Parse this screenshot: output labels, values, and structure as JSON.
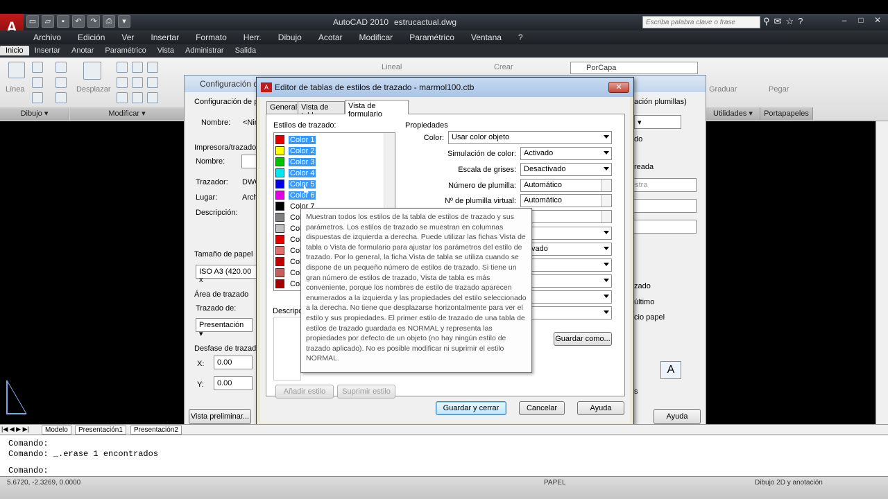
{
  "app": {
    "title": "AutoCAD 2010",
    "filename": "estrucactual.dwg",
    "logo_letter": "A",
    "search_placeholder": "Escriba palabra clave o frase"
  },
  "menubar": [
    "Archivo",
    "Edición",
    "Ver",
    "Insertar",
    "Formato",
    "Herr.",
    "Dibujo",
    "Acotar",
    "Modificar",
    "Paramétrico",
    "Ventana",
    "?"
  ],
  "ribbon_tabs": [
    "Inicio",
    "Insertar",
    "Anotar",
    "Paramétrico",
    "Vista",
    "Administrar",
    "Salida"
  ],
  "ribbon": {
    "panels": [
      "Dibujo",
      "Modificar",
      "Utilidades",
      "Portapapeles"
    ],
    "labels": {
      "linea": "Línea",
      "desplazar": "Desplazar",
      "lineal": "Lineal",
      "crear": "Crear",
      "porcapa": "PorCapa",
      "graduar": "Graduar",
      "pegar": "Pegar"
    }
  },
  "bg_dialog": {
    "title": "Configuración d",
    "config_label": "Configuración de pá",
    "nombre_label": "Nombre:",
    "nombre_value": "<Nin",
    "impresora_label": "Impresora/trazador",
    "nombre2_label": "Nombre:",
    "trazador_label": "Trazador:",
    "trazador_value": "DWG",
    "lugar_label": "Lugar:",
    "lugar_value": "Arch",
    "descripcion_label": "Descripción:",
    "tamano_label": "Tamaño de papel",
    "tamano_value": "ISO A3 (420.00 x",
    "area_label": "Área de trazado",
    "trazado_de_label": "Trazado de:",
    "trazado_de_value": "Presentación",
    "desfase_label": "Desfase de trazado",
    "x_label": "X:",
    "x_value": "0.00",
    "y_label": "Y:",
    "y_value": "0.00",
    "vista_btn": "Vista preliminar...",
    "ayuda_btn": "Ayuda",
    "right_plumillas": "ación plumillas)",
    "right_do": "do",
    "right_reada": "reada",
    "right_estra": "estra",
    "right_zado": "zado",
    "right_ultimo": "último",
    "right_papel": "cio papel",
    "right_s": "s",
    "right_a": "A"
  },
  "dialog": {
    "title": "Editor de tablas de estilos de trazado - marmol100.ctb",
    "tabs": [
      "General",
      "Vista de tabla",
      "Vista de formulario"
    ],
    "estilos_label": "Estilos de trazado:",
    "styles": [
      {
        "name": "Color 1",
        "color": "#e00000",
        "selected": true
      },
      {
        "name": "Color 2",
        "color": "#ffff00",
        "selected": true
      },
      {
        "name": "Color 3",
        "color": "#00c000",
        "selected": true
      },
      {
        "name": "Color 4",
        "color": "#00e5ee",
        "selected": true
      },
      {
        "name": "Color 5",
        "color": "#0000e0",
        "selected": true
      },
      {
        "name": "Color 6",
        "color": "#e000e0",
        "selected": true
      },
      {
        "name": "Color 7",
        "color": "#000000",
        "selected": false
      },
      {
        "name": "Color",
        "color": "#808080",
        "selected": false
      },
      {
        "name": "Color",
        "color": "#c0c0c0",
        "selected": false
      },
      {
        "name": "Color",
        "color": "#e00000",
        "selected": false
      },
      {
        "name": "Color",
        "color": "#e07070",
        "selected": false
      },
      {
        "name": "Color",
        "color": "#c00000",
        "selected": false
      },
      {
        "name": "Color",
        "color": "#c06060",
        "selected": false
      },
      {
        "name": "Color",
        "color": "#a00000",
        "selected": false
      }
    ],
    "descripcion_label": "Descripc",
    "anadir_btn": "Añadir estilo",
    "suprimir_btn": "Suprimir estilo",
    "propiedades_label": "Propiedades",
    "props": {
      "color_label": "Color:",
      "color_value": "Usar color objeto",
      "simulacion_label": "Simulación de color:",
      "simulacion_value": "Activado",
      "escala_label": "Escala de grises:",
      "escala_value": "Desactivado",
      "plumilla_label": "Número de plumilla:",
      "plumilla_value": "Automático",
      "virtual_label": "Nº de plumilla virtual:",
      "virtual_value": "Automático",
      "activado2": "ctivado"
    },
    "guardar_como_btn": "Guardar como...",
    "guardar_cerrar_btn": "Guardar y cerrar",
    "cancelar_btn": "Cancelar",
    "ayuda_btn": "Ayuda"
  },
  "tooltip": "Muestran todos los estilos de la tabla de estilos de trazado y sus parámetros. Los estilos de trazado se muestran en columnas dispuestas de izquierda a derecha. Puede utilizar las fichas Vista de tabla o Vista de formulario para ajustar los parámetros del estilo de trazado. Por lo general, la ficha Vista de tabla se utiliza cuando se dispone de un pequeño número de estilos de trazado. Si tiene un gran número de estilos de trazado, Vista de tabla es más conveniente, porque los nombres de estilo de trazado aparecen enumerados a la izquierda y las propiedades del estilo seleccionado a la derecha. No tiene que desplazarse horizontalmente para ver el estilo y sus propiedades. El primer estilo de trazado de una tabla de estilos de trazado guardada es NORMAL y representa las propiedades por defecto de un objeto (no hay ningún estilo de trazado aplicado). No es posible modificar ni suprimir el estilo NORMAL.",
  "layout_tabs": [
    "Modelo",
    "Presentación1",
    "Presentación2"
  ],
  "command": {
    "line1": "Comando:",
    "line2": "Comando:  _.erase 1 encontrados",
    "line3": "Comando:"
  },
  "status": {
    "coords": "5.6720, -2.3269, 0.0000",
    "papel": "PAPEL",
    "workspace": "Dibujo 2D y anotación"
  }
}
